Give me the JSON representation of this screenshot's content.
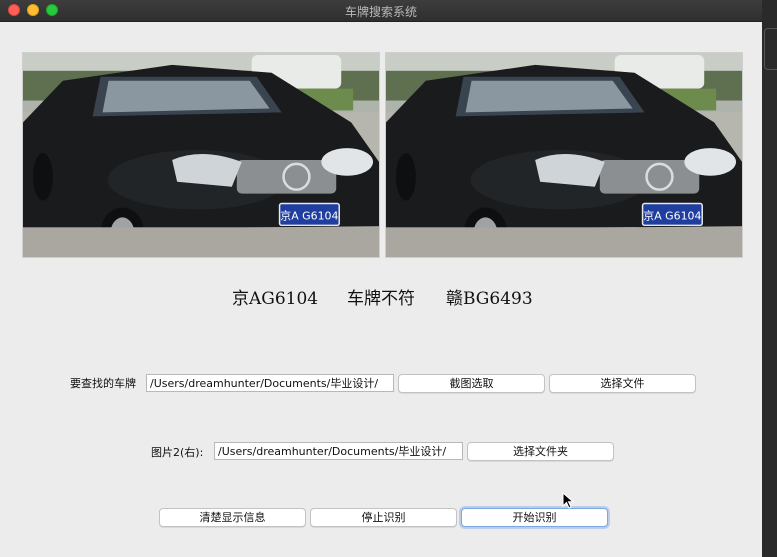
{
  "window": {
    "title": "车牌搜索系统"
  },
  "images": {
    "left_plate": "京A G6104",
    "right_plate": "京A G6104"
  },
  "results": {
    "plate_left": "京AG6104",
    "match_status": "车牌不符",
    "plate_right": "赣BG6493"
  },
  "search_row": {
    "label": "要查找的车牌",
    "path_value": "/Users/dreamhunter/Documents/毕业设计/",
    "screenshot_button": "截图选取",
    "choose_file_button": "选择文件"
  },
  "folder_row": {
    "label": "图片2(右):",
    "path_value": "/Users/dreamhunter/Documents/毕业设计/",
    "choose_folder_button": "选择文件夹"
  },
  "actions": {
    "clear_button": "清楚显示信息",
    "stop_button": "停止识别",
    "start_button": "开始识别"
  },
  "colors": {
    "window_bg": "#ececec",
    "titlebar": "#333333",
    "focus_ring": "#7aa7e0",
    "plate_blue": "#1f3ea0"
  }
}
